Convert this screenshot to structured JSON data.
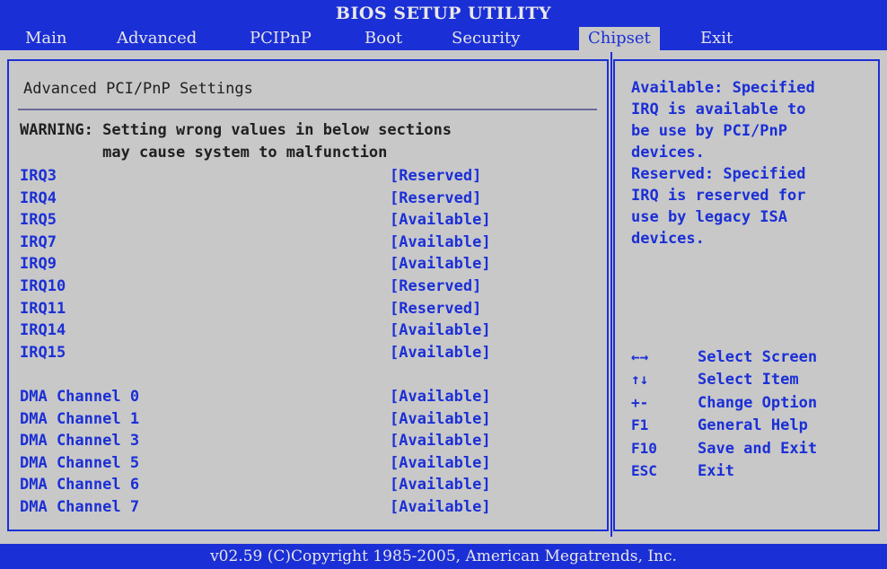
{
  "title": "BIOS SETUP UTILITY",
  "menu": [
    {
      "label": "Main"
    },
    {
      "label": "Advanced"
    },
    {
      "label": "PCIPnP"
    },
    {
      "label": "Boot"
    },
    {
      "label": "Security"
    },
    {
      "label": "Chipset"
    },
    {
      "label": "Exit"
    }
  ],
  "main": {
    "section_title": "Advanced PCI/PnP Settings",
    "warning_line1": "WARNING: Setting wrong values in below sections",
    "warning_line2": "         may cause system to malfunction",
    "irq_rows": [
      {
        "label": "IRQ3",
        "value": "[Reserved]"
      },
      {
        "label": "IRQ4",
        "value": "[Reserved]"
      },
      {
        "label": "IRQ5",
        "value": "[Available]"
      },
      {
        "label": "IRQ7",
        "value": "[Available]"
      },
      {
        "label": "IRQ9",
        "value": "[Available]"
      },
      {
        "label": "IRQ10",
        "value": "[Reserved]"
      },
      {
        "label": "IRQ11",
        "value": "[Reserved]"
      },
      {
        "label": "IRQ14",
        "value": "[Available]"
      },
      {
        "label": "IRQ15",
        "value": "[Available]"
      }
    ],
    "dma_rows": [
      {
        "label": "DMA Channel 0",
        "value": "[Available]"
      },
      {
        "label": "DMA Channel 1",
        "value": "[Available]"
      },
      {
        "label": "DMA Channel 3",
        "value": "[Available]"
      },
      {
        "label": "DMA Channel 5",
        "value": "[Available]"
      },
      {
        "label": "DMA Channel 6",
        "value": "[Available]"
      },
      {
        "label": "DMA Channel 7",
        "value": "[Available]"
      }
    ]
  },
  "help": {
    "text": "Available: Specified\nIRQ is available to\nbe use by PCI/PnP\ndevices.\nReserved: Specified\nIRQ is reserved for\nuse by legacy ISA\ndevices.",
    "keys": [
      {
        "key": "←→",
        "desc": "Select Screen"
      },
      {
        "key": "↑↓",
        "desc": "Select Item"
      },
      {
        "key": "+-",
        "desc": "Change Option"
      },
      {
        "key": "F1",
        "desc": "General Help"
      },
      {
        "key": "F10",
        "desc": "Save and Exit"
      },
      {
        "key": "ESC",
        "desc": "Exit"
      }
    ]
  },
  "footer": "v02.59  (C)Copyright 1985-2005, American Megatrends, Inc.",
  "colors": {
    "bar_blue": "#1b2fd6",
    "background_gray": "#c8c8c8",
    "text_dark": "#202020"
  }
}
